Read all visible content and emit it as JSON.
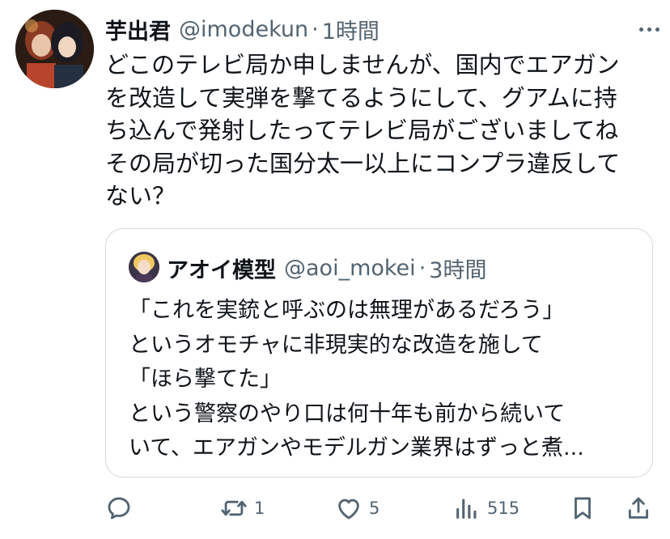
{
  "tweet": {
    "author_name": "芋出君",
    "author_handle": "@imodekun",
    "separator": "·",
    "time": "1時間",
    "text_lines": [
      "どこのテレビ局か申しませんが、国内でエアガン",
      "を改造して実弾を撃てるようにして、グアムに持",
      "ち込んで発射したってテレビ局がございましてね",
      "その局が切った国分太一以上にコンプラ違反して",
      "ない？"
    ]
  },
  "quote": {
    "author_name": "アオイ模型",
    "author_handle": "@aoi_mokei",
    "separator": "·",
    "time": "3時間",
    "text_lines": [
      "「これを実銃と呼ぶのは無理があるだろう」",
      "というオモチャに非現実的な改造を施して",
      "「ほら撃てた」",
      "という警察のやり口は何十年も前から続いて",
      "いて、エアガンやモデルガン業界はずっと煮..."
    ]
  },
  "actions": {
    "reply_count": "",
    "retweet_count": "1",
    "like_count": "5",
    "views_count": "515"
  },
  "icons": {
    "more": "more-icon",
    "reply": "reply-icon",
    "retweet": "retweet-icon",
    "like": "heart-icon",
    "views": "views-icon",
    "bookmark": "bookmark-icon",
    "share": "share-icon"
  },
  "colors": {
    "text": "#0f1419",
    "secondary": "#536471",
    "border": "#cfd9de"
  }
}
